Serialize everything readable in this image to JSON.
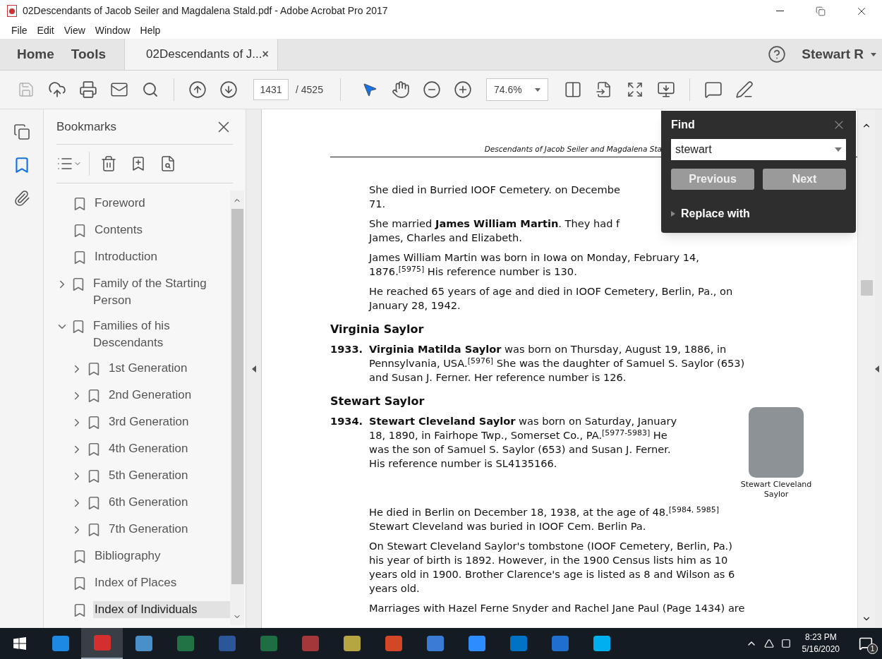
{
  "window": {
    "title": "02Descendants of Jacob Seiler and Magdalena Stald.pdf - Adobe Acrobat Pro 2017"
  },
  "menu": [
    "File",
    "Edit",
    "View",
    "Window",
    "Help"
  ],
  "tabs": [
    {
      "label": "Home",
      "kind": "nav",
      "selected": false
    },
    {
      "label": "Tools",
      "kind": "nav",
      "selected": false
    },
    {
      "label": "02Descendants of J...",
      "kind": "document",
      "close": "×",
      "selected": true
    }
  ],
  "account": {
    "name": "Stewart R"
  },
  "toolbar": {
    "page": "1431",
    "page_total": "/ 4525",
    "zoom": "74.6%"
  },
  "bookmarks": {
    "title": "Bookmarks",
    "items": [
      {
        "label": "Foreword",
        "kind": "leaf",
        "selected": false
      },
      {
        "label": "Contents",
        "kind": "leaf",
        "selected": false
      },
      {
        "label": "Introduction",
        "kind": "leaf",
        "selected": false
      },
      {
        "label": "Family of the Starting Person",
        "kind": "group",
        "expanded": false,
        "selected": false
      },
      {
        "label": "Families of his Descendants",
        "kind": "group",
        "expanded": true,
        "selected": false,
        "children": [
          {
            "label": "1st Generation",
            "kind": "group",
            "expanded": false,
            "selected": false
          },
          {
            "label": "2nd Generation",
            "kind": "group",
            "expanded": false,
            "selected": false
          },
          {
            "label": "3rd Generation",
            "kind": "group",
            "expanded": false,
            "selected": false
          },
          {
            "label": "4th Generation",
            "kind": "group",
            "expanded": false,
            "selected": false
          },
          {
            "label": "5th Generation",
            "kind": "group",
            "expanded": false,
            "selected": false
          },
          {
            "label": "6th Generation",
            "kind": "group",
            "expanded": false,
            "selected": false
          },
          {
            "label": "7th Generation",
            "kind": "group",
            "expanded": false,
            "selected": false
          }
        ]
      },
      {
        "label": "Bibliography",
        "kind": "leaf",
        "selected": false
      },
      {
        "label": "Index of Places",
        "kind": "leaf",
        "selected": false
      },
      {
        "label": "Index of Individuals",
        "kind": "leaf",
        "selected": true
      }
    ]
  },
  "document": {
    "blocks": [
      {
        "kind": "header",
        "text": "Descendants of Jacob Seiler and Magdalena Sta"
      },
      {
        "kind": "para",
        "lines": [
          "She died in Burried IOOF Cemetery. on Decembe",
          "71."
        ]
      },
      {
        "kind": "para",
        "lines": [
          "She married **James William Martin**. They had f",
          "James, Charles and Elizabeth."
        ]
      },
      {
        "kind": "para",
        "lines": [
          "James William Martin was born in Iowa on Monday, February 14,",
          "1876.$^{[5975]}$ His reference number is 130."
        ]
      },
      {
        "kind": "para",
        "lines": [
          "He reached 65 years of age and died in IOOF Cemetery, Berlin, Pa., on",
          "January 28, 1942."
        ]
      },
      {
        "kind": "heading",
        "text": "Virginia Saylor"
      },
      {
        "kind": "entry",
        "number": "1933.",
        "lines": [
          "**Virginia Matilda Saylor** was born on Thursday, August 19, 1886, in",
          "Pennsylvania, USA.$^{[5976]}$ She was the daughter of Samuel S. Saylor (653)",
          "and Susan J. Ferner. Her reference number is 126."
        ]
      },
      {
        "kind": "heading",
        "text": "Stewart Saylor"
      },
      {
        "kind": "entry",
        "number": "1934.",
        "lines": [
          "**Stewart Cleveland Saylor** was born on Saturday, January",
          "18, 1890, in Fairhope Twp., Somerset Co., PA.$^{[5977-5983]}$ He",
          "was the son of Samuel S. Saylor (653) and Susan J. Ferner.",
          "His reference number is SL4135166."
        ],
        "figure": {
          "caption": "Stewart Cleveland Saylor"
        }
      },
      {
        "kind": "para",
        "lines": [
          "He died in Berlin on December 18, 1938, at the age of 48.$^{[5984, 5985]}$",
          "Stewart Cleveland was buried in IOOF Cem. Berlin Pa."
        ]
      },
      {
        "kind": "para",
        "lines": [
          "On Stewart Cleveland Saylor's tombstone (IOOF Cemetery, Berlin, Pa.)",
          "his year of birth is 1892.   However, in the 1900 Census lists him as 10",
          "years old in 1900. Brother Clarence's age is listed as 8 and Wilson as 6",
          "years old."
        ]
      },
      {
        "kind": "para",
        "lines": [
          "Marriages with Hazel Ferne Snyder and Rachel Jane Paul (Page 1434) are"
        ]
      }
    ]
  },
  "find": {
    "title": "Find",
    "value": "stewart",
    "buttons": [
      "Previous",
      "Next"
    ],
    "replace": {
      "label": "Replace with",
      "expanded": false
    }
  },
  "taskbar": {
    "apps": [
      {
        "color": "#1e88e5",
        "selected": false
      },
      {
        "color": "#d32f2f",
        "selected": true
      },
      {
        "color": "#4a90c8",
        "selected": false
      },
      {
        "color": "#217346",
        "selected": false
      },
      {
        "color": "#2b579a",
        "selected": false
      },
      {
        "color": "#1d6f42",
        "selected": false
      },
      {
        "color": "#a4373a",
        "selected": false
      },
      {
        "color": "#b5a642",
        "selected": false
      },
      {
        "color": "#d24726",
        "selected": false
      },
      {
        "color": "#3a7bd5",
        "selected": false
      },
      {
        "color": "#2d8cff",
        "selected": false
      },
      {
        "color": "#0072c6",
        "selected": false
      },
      {
        "color": "#1f6fd1",
        "selected": false
      },
      {
        "color": "#00aff0",
        "selected": false
      }
    ],
    "time": "8:23 PM",
    "date": "5/16/2020",
    "notifications": "1"
  }
}
